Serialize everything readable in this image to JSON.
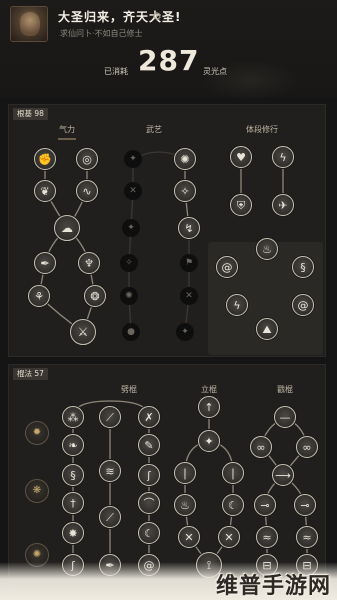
{
  "header": {
    "title": "大圣归来，齐天大圣!",
    "subtitle": "求仙问卜·不如自己修士",
    "settings_icon": "gear-icon",
    "points_used_label": "已消耗",
    "points_value": "287",
    "points_unit_label": "灵光点"
  },
  "panel1": {
    "tag": "根基 98",
    "columns": [
      "气力",
      "武艺",
      "体段修行"
    ]
  },
  "panel2": {
    "tag": "棍法 57",
    "columns": [
      "劈棍",
      "立棍",
      "戳棍"
    ]
  },
  "watermark": "维普手游网",
  "colors": {
    "background": "#151515",
    "panel": "#211f1d",
    "node_border": "#c9c3b5",
    "accent": "#6b5e4a"
  }
}
